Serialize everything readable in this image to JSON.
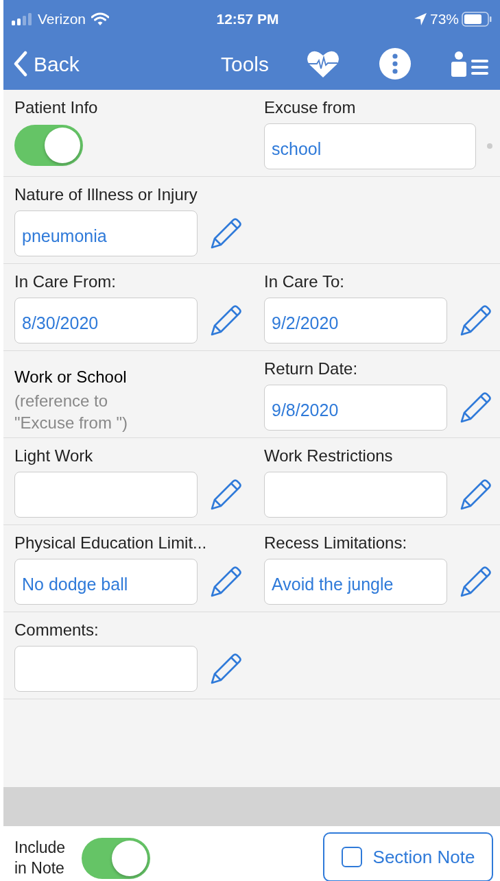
{
  "status_bar": {
    "carrier": "Verizon",
    "time": "12:57 PM",
    "battery": "73%"
  },
  "nav_bar": {
    "back": "Back",
    "title": "Tools"
  },
  "rows": [
    {
      "cells": [
        {
          "kind": "toggle",
          "label": "Patient Info",
          "on": true
        },
        {
          "kind": "dropdown",
          "label": "Excuse from",
          "value": "school"
        }
      ]
    },
    {
      "cells": [
        {
          "kind": "field",
          "label": "Nature of Illness or Injury",
          "value": "pneumonia"
        }
      ]
    },
    {
      "cells": [
        {
          "kind": "field",
          "label": "In Care From:",
          "value": "8/30/2020"
        },
        {
          "kind": "field",
          "label": "In Care To:",
          "value": "9/2/2020"
        }
      ]
    },
    {
      "cells": [
        {
          "kind": "note",
          "label": "Work or School",
          "note": "(reference to \"Excuse from \")"
        },
        {
          "kind": "field",
          "label": "Return Date:",
          "value": "9/8/2020"
        }
      ]
    },
    {
      "cells": [
        {
          "kind": "field",
          "label": "Light Work"
        },
        {
          "kind": "field",
          "label": "Work Restrictions"
        }
      ]
    },
    {
      "cells": [
        {
          "kind": "field",
          "label": "Physical Education Limit...",
          "value": "No dodge ball"
        },
        {
          "kind": "field",
          "label": "Recess Limitations:",
          "value": "Avoid the jungle"
        }
      ]
    },
    {
      "cells": [
        {
          "kind": "field",
          "label": "Comments:"
        }
      ]
    }
  ],
  "footer": {
    "include_label": "Include in Note",
    "include_on": true,
    "section_note": "Section Note",
    "section_note_checked": false
  }
}
